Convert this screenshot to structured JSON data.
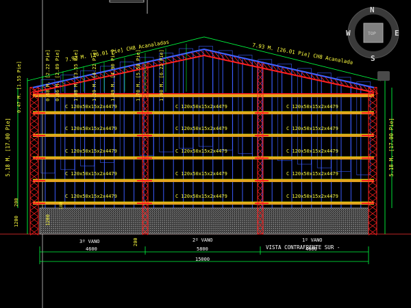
{
  "drawing": {
    "roof_left": "7.93 M. [26.01 Pie] CH8 Acanaladas",
    "roof_right": "7.93 M. [26.01 Pie] CH8 Acanalada",
    "vert_dims_left": [
      "0.47 M. [1.55 Pie]",
      "0.68 M. [2.22 Pie]",
      "0.86 M. [2.89 Pie]",
      "1.08 M. [3.55 Pie]",
      "1.29 M. [4.22 Pie]",
      "1.49 M. [4.90 Pie]",
      "1.70 M. [5.58 Pie]",
      "1.90 M. [6.22 Pie]"
    ],
    "side_left": "5.18 M. [17.00 Pie]",
    "side_right": "5.18 M. [17.00 Pie]",
    "purlin_label": "C 120x50x15x2x4479",
    "small_left_top": "200",
    "small_left_bottom": "1200",
    "small_left_inner": "1200",
    "small_mid": "200",
    "small_right": "180",
    "bays": [
      {
        "name": "3º VANO",
        "dim": "4600"
      },
      {
        "name": "2º VANO",
        "dim": "5800"
      },
      {
        "name": "1º VANO",
        "dim": "4600"
      }
    ],
    "total": "15000",
    "view_title": "VISTA CONTRAFRENTE SUR -"
  },
  "viewcube": {
    "n": "N",
    "s": "S",
    "e": "E",
    "w": "W",
    "top": "TOP"
  },
  "colors": {
    "background": "#000000",
    "frame_red": "#ff2020",
    "purlin_yellow": "#ffff00",
    "girt_blue": "#3a5cff",
    "dim_green": "#00ff40",
    "roof_blue": "#4060ff",
    "wood_orange": "#e0a020",
    "hatch_gray": "#909090"
  }
}
